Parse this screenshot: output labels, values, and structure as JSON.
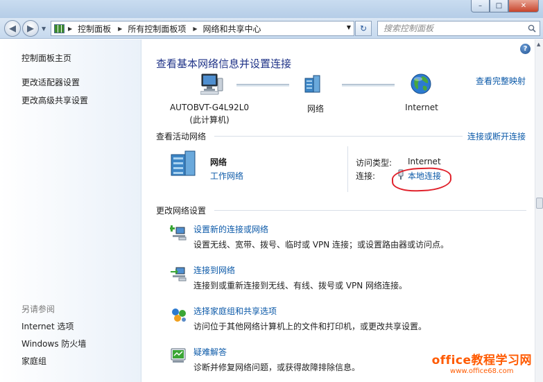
{
  "window": {
    "min": "–",
    "max": "□",
    "close": "✕"
  },
  "breadcrumb": [
    "控制面板",
    "所有控制面板项",
    "网络和共享中心"
  ],
  "search": {
    "placeholder": "搜索控制面板"
  },
  "sidebar": {
    "items": [
      "控制面板主页",
      "更改适配器设置",
      "更改高级共享设置"
    ],
    "see_also_label": "另请参阅",
    "see_also": [
      "Internet 选项",
      "Windows 防火墙",
      "家庭组"
    ]
  },
  "main": {
    "title": "查看基本网络信息并设置连接",
    "full_map": "查看完整映射",
    "nodes": [
      {
        "name": "AUTOBVT-G4L92L0",
        "sub": "(此计算机)"
      },
      {
        "name": "网络",
        "sub": ""
      },
      {
        "name": "Internet",
        "sub": ""
      }
    ],
    "active_section": "查看活动网络",
    "connect_disconnect": "连接或断开连接",
    "network": {
      "name": "网络",
      "type": "工作网络"
    },
    "access_type_label": "访问类型:",
    "access_type_value": "Internet",
    "connections_label": "连接:",
    "connection_value": "本地连接",
    "change_section": "更改网络设置",
    "tasks": [
      {
        "title": "设置新的连接或网络",
        "desc": "设置无线、宽带、拨号、临时或 VPN 连接；或设置路由器或访问点。",
        "icon": "new-connection-icon"
      },
      {
        "title": "连接到网络",
        "desc": "连接到或重新连接到无线、有线、拨号或 VPN 网络连接。",
        "icon": "connect-network-icon"
      },
      {
        "title": "选择家庭组和共享选项",
        "desc": "访问位于其他网络计算机上的文件和打印机，或更改共享设置。",
        "icon": "homegroup-icon"
      },
      {
        "title": "疑难解答",
        "desc": "诊断并修复网络问题，或获得故障排除信息。",
        "icon": "troubleshoot-icon"
      }
    ]
  },
  "watermark": {
    "main": "office教程学习网",
    "sub": "www.office68.com"
  },
  "colors": {
    "link": "#0b59a8",
    "title": "#1e3287",
    "annotation": "#e0202a",
    "watermark": "#ff5a00"
  }
}
